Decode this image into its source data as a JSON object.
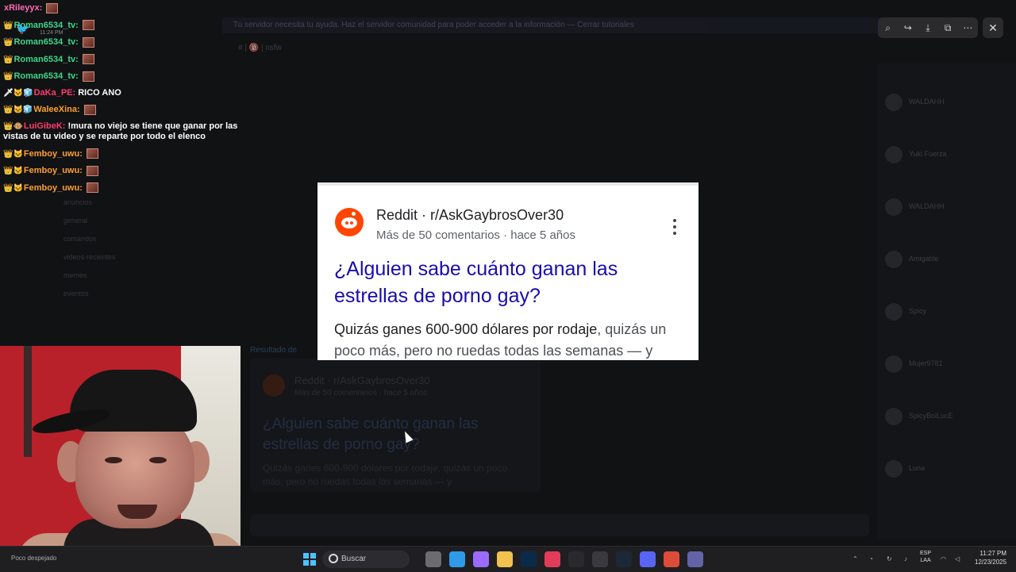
{
  "background_app": {
    "banner": "Tu servidor necesita tu ayuda. Haz el servidor comunidad para poder acceder a la información — Cerrar tutoriales",
    "channel_header": "# | 🔞 | nsfw",
    "section_label": "Resultado de",
    "channels": [
      "anuncios",
      "general",
      "comandos",
      "videos-recientes",
      "memes",
      "eventos"
    ],
    "members": [
      "WALDAHH",
      "Yuki Fuerza",
      "WALDAHH",
      "Amigable",
      "Spicy",
      "Mujer9781",
      "SpicyBoiLucE",
      "Luna"
    ],
    "embed_source": "Reddit · r/AskGaybrosOver30",
    "embed_meta": "Más de 50 comentarios · hace 5 años",
    "embed_title": "¿Alguien sabe cuánto ganan las estrellas de porno gay?",
    "embed_snippet": "Quizás ganes 600-900 dólares por rodaje, quizás un poco más, pero no ruedas todas las semanas — y"
  },
  "viewer_toolbar": {
    "zoom": "zoom-icon",
    "share": "share-icon",
    "download": "download-icon",
    "open": "open-external-icon",
    "more": "more-icon",
    "close": "close-icon"
  },
  "chat": {
    "timestamp": "11:24 PM",
    "messages": [
      {
        "badges": "",
        "user": "xRileyyx:",
        "color": "#ff69b4",
        "text": "",
        "emote": true
      },
      {
        "badges": "👑",
        "user": "Roman6534_tv:",
        "color": "#3fd68b",
        "text": "",
        "emote": true
      },
      {
        "badges": "👑",
        "user": "Roman6534_tv:",
        "color": "#3fd68b",
        "text": "",
        "emote": true
      },
      {
        "badges": "👑",
        "user": "Roman6534_tv:",
        "color": "#3fd68b",
        "text": "",
        "emote": true
      },
      {
        "badges": "👑",
        "user": "Roman6534_tv:",
        "color": "#3fd68b",
        "text": "",
        "emote": true
      },
      {
        "badges": "🗡🐱🧊",
        "user": "DaKa_PE:",
        "color": "#ff3b6b",
        "text": "RICO ANO",
        "emote": false
      },
      {
        "badges": "👑🐱🧊",
        "user": "WaleeXina:",
        "color": "#ff9f2e",
        "text": "",
        "emote": true
      },
      {
        "badges": "👑🐵",
        "user": "LuiGibeK:",
        "color": "#ff3b6b",
        "text": "!mura no viejo se tiene que ganar por las vistas de tu video y se reparte por todo el elenco",
        "emote": false
      },
      {
        "badges": "👑🐱",
        "user": "Femboy_uwu:",
        "color": "#ff9f2e",
        "text": "",
        "emote": true
      },
      {
        "badges": "👑🐱",
        "user": "Femboy_uwu:",
        "color": "#ff9f2e",
        "text": "",
        "emote": true
      },
      {
        "badges": "👑🐱",
        "user": "Femboy_uwu:",
        "color": "#ff9f2e",
        "text": "",
        "emote": true
      }
    ]
  },
  "card": {
    "source": "Reddit · r/AskGaybrosOver30",
    "meta": "Más de 50 comentarios · hace 5 años",
    "title": "¿Alguien sabe cuánto ganan las estrellas de porno gay?",
    "snippet_bold": "Quizás ganes 600-900 dólares por rodaje",
    "snippet_rest": ", quizás un poco más, pero no ruedas todas las semanas — y",
    "logo": "reddit-logo-icon",
    "menu": "more-vert-icon"
  },
  "taskbar": {
    "weather": "Poco despejado",
    "search_label": "Buscar",
    "lang_line1": "ESP",
    "lang_line2": "LAA",
    "time": "11:27 PM",
    "date": "12/23/2025",
    "apps": [
      {
        "name": "files-icon",
        "color": "#6b6b70"
      },
      {
        "name": "edge-icon",
        "color": "#2f9be8"
      },
      {
        "name": "copilot-icon",
        "color": "#9b6bff"
      },
      {
        "name": "folder-icon",
        "color": "#f2c14e"
      },
      {
        "name": "photoshop-icon",
        "color": "#0b2a4a"
      },
      {
        "name": "music-icon",
        "color": "#e33c5a"
      },
      {
        "name": "obs-icon",
        "color": "#2a2a2e"
      },
      {
        "name": "epic-icon",
        "color": "#3a3a3e"
      },
      {
        "name": "steam-icon",
        "color": "#1b2838"
      },
      {
        "name": "discord-icon",
        "color": "#5865f2"
      },
      {
        "name": "chrome-icon",
        "color": "#dd4b39"
      },
      {
        "name": "teams-icon",
        "color": "#6264a7"
      }
    ]
  }
}
